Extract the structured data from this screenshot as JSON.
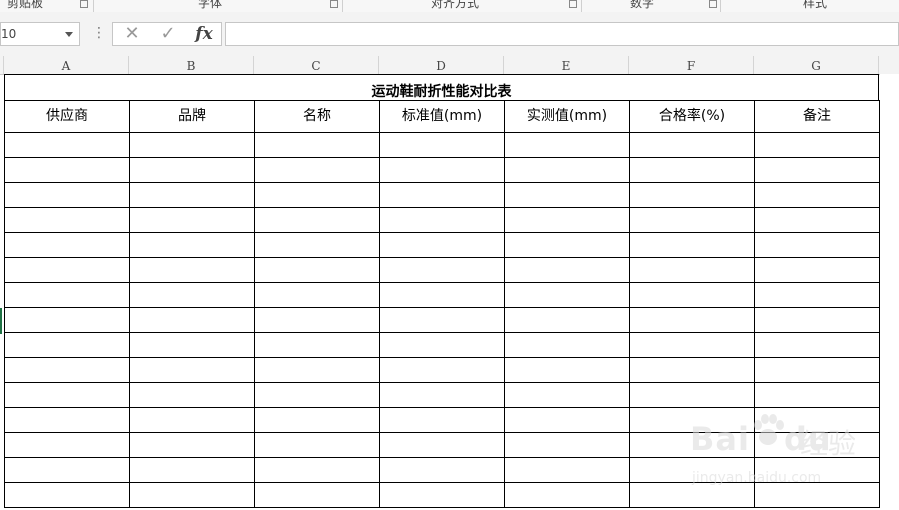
{
  "ribbon": {
    "groups": [
      {
        "label": "剪贴板"
      },
      {
        "label": "字体"
      },
      {
        "label": "对齐方式"
      },
      {
        "label": "数字"
      },
      {
        "label": "样式"
      }
    ]
  },
  "formula_bar": {
    "name_box": "10",
    "fx_label": "fx",
    "cancel_symbol": "✕",
    "enter_symbol": "✓",
    "formula_value": ""
  },
  "columns": [
    "A",
    "B",
    "C",
    "D",
    "E",
    "F",
    "G"
  ],
  "sheet": {
    "title": "运动鞋耐折性能对比表",
    "headers": [
      "供应商",
      "品牌",
      "名称",
      "标准值(mm)",
      "实测值(mm)",
      "合格率(%)",
      "备注"
    ],
    "empty_rows": 15
  },
  "watermark": {
    "brand": "Bai",
    "brand_suffix": "du",
    "chinese": "经验",
    "url": "jingyan.baidu.com"
  },
  "colors": {
    "selection_accent": "#217346",
    "grid_line": "#000000",
    "header_bg": "#f3f3f3"
  }
}
